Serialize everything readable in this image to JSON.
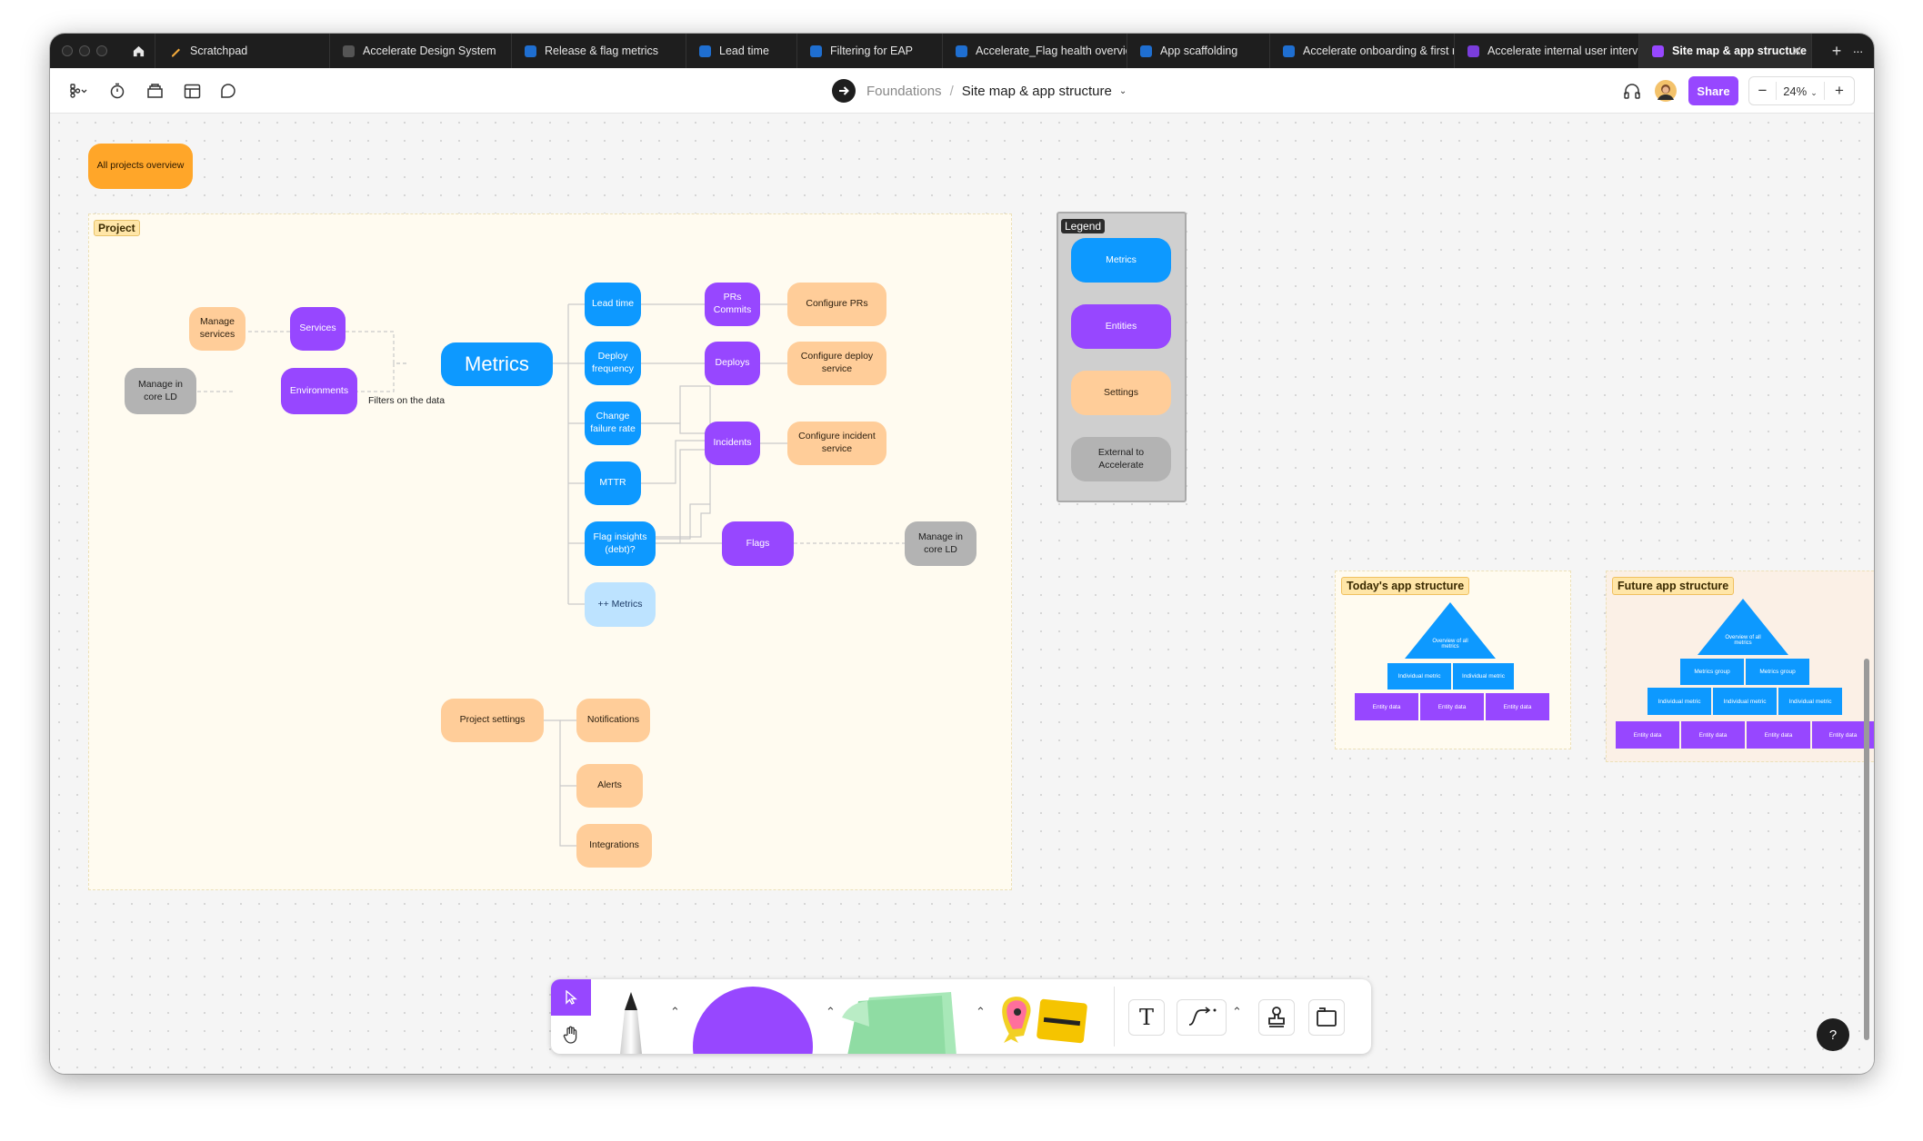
{
  "tabs": [
    {
      "label": "Scratchpad",
      "icon": "pencil-file-icon",
      "color": "#f2a93b"
    },
    {
      "label": "Accelerate Design System",
      "icon": "figma-file-icon",
      "color": "#6f6f6f"
    },
    {
      "label": "Release & flag metrics",
      "icon": "figjam-file-icon",
      "color": "#2f80ed"
    },
    {
      "label": "Lead time",
      "icon": "figjam-file-icon",
      "color": "#2f80ed"
    },
    {
      "label": "Filtering for EAP",
      "icon": "figjam-file-icon",
      "color": "#2f80ed"
    },
    {
      "label": "Accelerate_Flag health overview",
      "icon": "figjam-file-icon",
      "color": "#2f80ed"
    },
    {
      "label": "App scaffolding",
      "icon": "figjam-file-icon",
      "color": "#2f80ed"
    },
    {
      "label": "Accelerate onboarding & first run",
      "icon": "figjam-file-icon",
      "color": "#2f80ed"
    },
    {
      "label": "Accelerate internal user interviews",
      "icon": "slides-file-icon",
      "color": "#9747ff"
    },
    {
      "label": "Site map & app structure",
      "icon": "slides-file-icon",
      "color": "#9747ff",
      "active": true
    }
  ],
  "breadcrumb": {
    "team": "Foundations",
    "separator": "/",
    "file": "Site map & app structure"
  },
  "share_label": "Share",
  "zoom": "24%",
  "zoom_minus": "−",
  "zoom_plus": "+",
  "new_tab": "+",
  "tab_menu": "···",
  "canvas": {
    "all_projects": "All projects overview",
    "project_section": "Project",
    "filters_label": "Filters on the data",
    "nodes": {
      "manage_services": "Manage services",
      "services": "Services",
      "manage_core_ld_1": "Manage in core LD",
      "environments": "Environments",
      "metrics": "Metrics",
      "lead_time": "Lead time",
      "deploy_frequency": "Deploy frequency",
      "change_failure_rate": "Change failure rate",
      "mttr": "MTTR",
      "flag_insights": "Flag insights (debt)?",
      "more_metrics": "++ Metrics",
      "prs_commits": "PRs Commits",
      "deploys": "Deploys",
      "incidents": "Incidents",
      "flags": "Flags",
      "configure_prs": "Configure PRs",
      "configure_deploy": "Configure deploy service",
      "configure_incident": "Configure incident service",
      "manage_core_ld_2": "Manage in core LD",
      "project_settings": "Project settings",
      "notifications": "Notifications",
      "alerts": "Alerts",
      "integrations": "Integrations"
    },
    "legend": {
      "title": "Legend",
      "items": [
        "Metrics",
        "Entities",
        "Settings",
        "External to Accelerate"
      ]
    },
    "today": {
      "title": "Today's app structure",
      "top": "Overview of all metrics",
      "row1": [
        "Individual metric",
        "Individual metric"
      ],
      "row2": [
        "Entity data",
        "Entity data",
        "Entity data"
      ]
    },
    "future": {
      "title": "Future app structure",
      "top": "Overview of all metrics",
      "row1": [
        "Metrics group",
        "Metrics group"
      ],
      "row2": [
        "Individual metric",
        "Individual metric",
        "Individual metric"
      ],
      "row3": [
        "Entity data",
        "Entity data",
        "Entity data",
        "Entity data"
      ]
    }
  },
  "help_label": "?",
  "colors": {
    "metrics": "#0d99ff",
    "entities": "#9747ff",
    "settings": "#ffcd99",
    "external": "#b3b3b3",
    "accent": "#9747ff"
  }
}
